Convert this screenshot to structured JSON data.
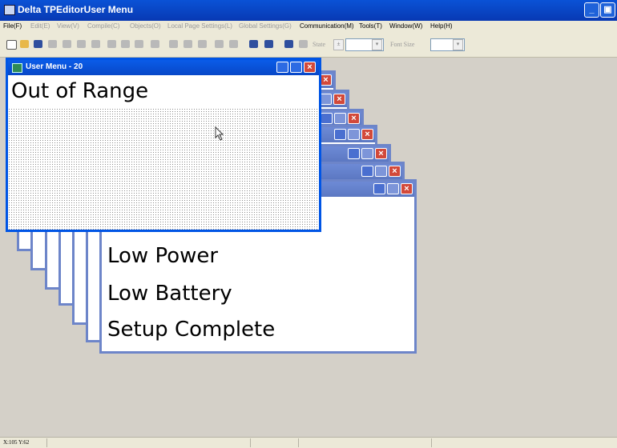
{
  "app": {
    "title": "Delta TPEditorUser Menu"
  },
  "menu": {
    "file": "File(F)",
    "edit": "Edit(E)",
    "view": "View(V)",
    "compile": "Compile(C)",
    "objects": "Objects(O)",
    "local": "Local Page Settings(L)",
    "global": "Global Settings(G)",
    "comm": "Communication(M)",
    "tools": "Tools(T)",
    "window": "Window(W)",
    "help": "Help(H)"
  },
  "toolbar": {
    "state_label": "State",
    "font_size_label": "Font Size",
    "state_value": "",
    "font_size_value": ""
  },
  "front_window": {
    "title": "User Menu - 20",
    "text": "Out of Range"
  },
  "back_window": {
    "lines": [
      "Low Power",
      "Low Battery",
      "Setup Complete"
    ]
  },
  "status": {
    "coords": "X:105  Y:62"
  },
  "colors": {
    "titlebar": "#0a52d6",
    "workspace": "#d4d0c8",
    "close": "#d2493a"
  }
}
